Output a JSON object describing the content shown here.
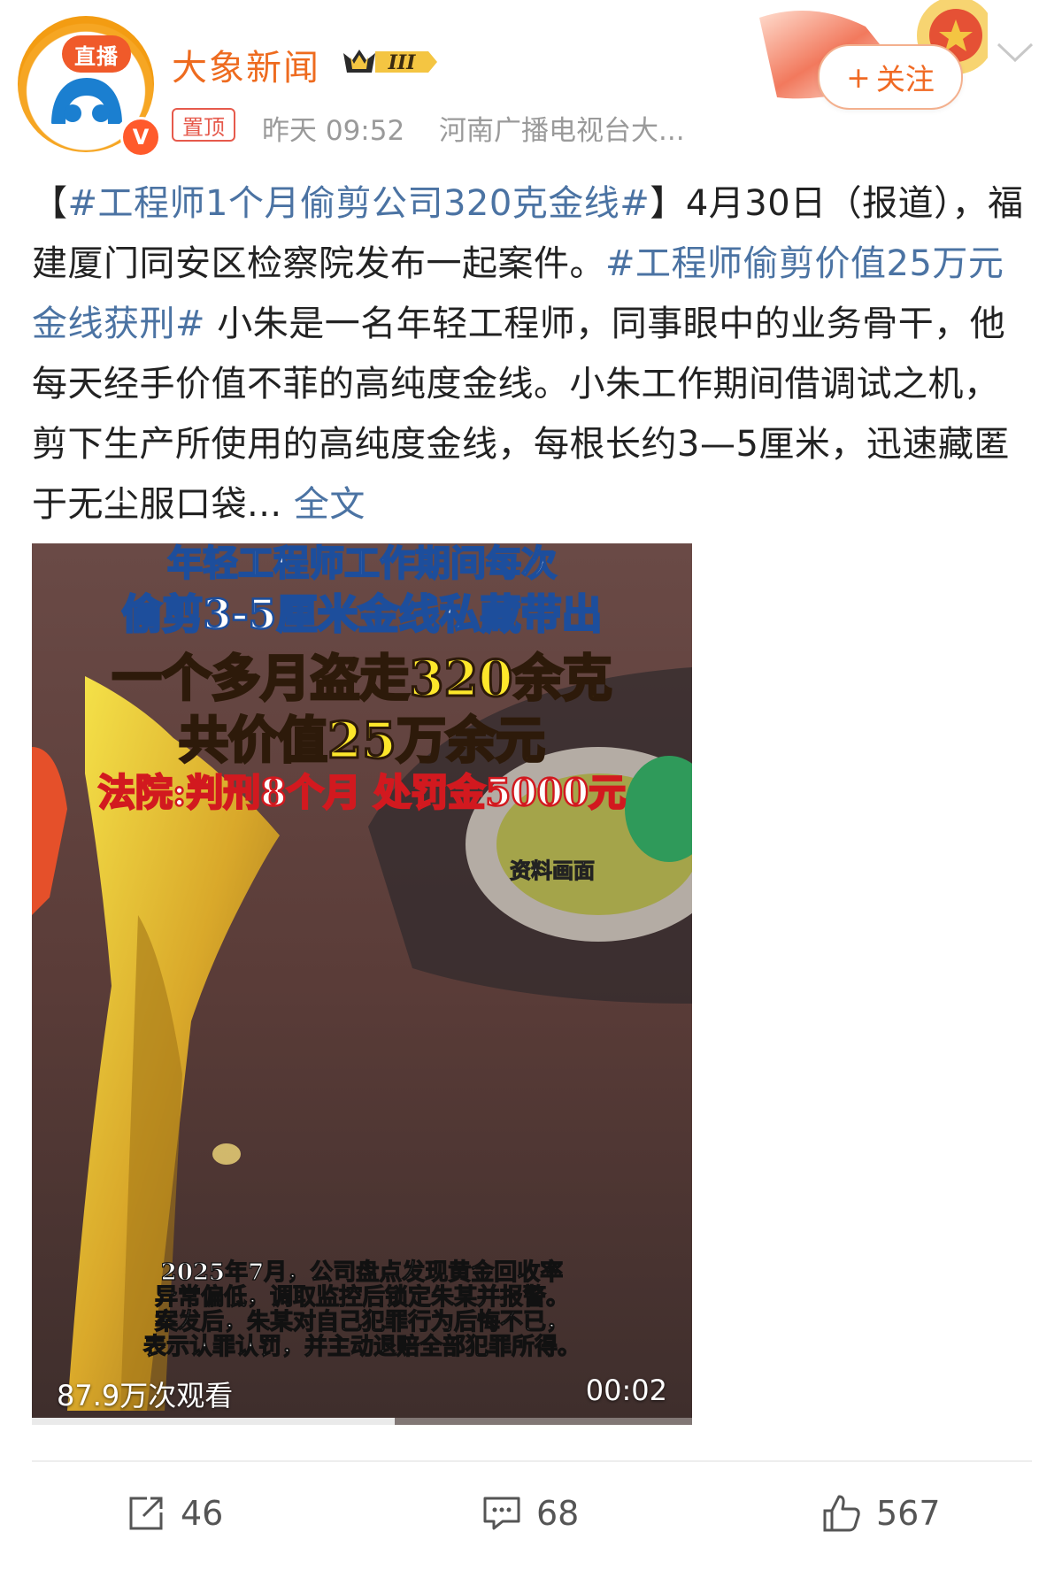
{
  "header": {
    "avatar_live_label": "直播",
    "avatar_verified_mark": "V",
    "account_name": "大象新闻",
    "vip_level": "III",
    "pin_label": "置顶",
    "time": "昨天 09:52",
    "source": "河南广播电视台大...",
    "follow_label": "关注",
    "follow_plus": "+"
  },
  "post": {
    "topic_1": "#工程师1个月偷剪公司320克金线#",
    "text_1": "4月30日（报道），福建厦门同安区检察院发布一起案件。",
    "topic_2": "#工程师偷剪价值25万元金线获刑#",
    "text_2": " 小朱是一名年轻工程师，同事眼中的业务骨干，他每天经手价值不菲的高纯度金线。小朱工作期间借调试之机，剪下生产所使用的高纯度金线，每根长约3—5厘米，迅速藏匿于无尘服口袋...",
    "more_label": "全文"
  },
  "video": {
    "caption_1": "年轻工程师工作期间每次",
    "caption_2": "偷剪3-5厘米金线私藏带出",
    "caption_3": "一个多月盗走320余克",
    "caption_4": "共价值25万余元",
    "caption_5": "法院:判刑8个月 处罚金5000元",
    "source_tag": "资料画面",
    "subtitle_1": "2025年7月，公司盘点发现黄金回收率",
    "subtitle_2": "异常偏低，调取监控后锁定朱某并报警。",
    "subtitle_3": "案发后，朱某对自己犯罪行为后悔不已，",
    "subtitle_4": "表示认罪认罚，并主动退赔全部犯罪所得。",
    "views": "87.9万次观看",
    "duration": "00:02",
    "progress": 0.55
  },
  "actions": {
    "share_count": "46",
    "comment_count": "68",
    "like_count": "567"
  },
  "colors": {
    "brand_orange": "#ee6b1f",
    "topic_blue": "#4b73a3",
    "pin_red": "#e65a4c"
  }
}
